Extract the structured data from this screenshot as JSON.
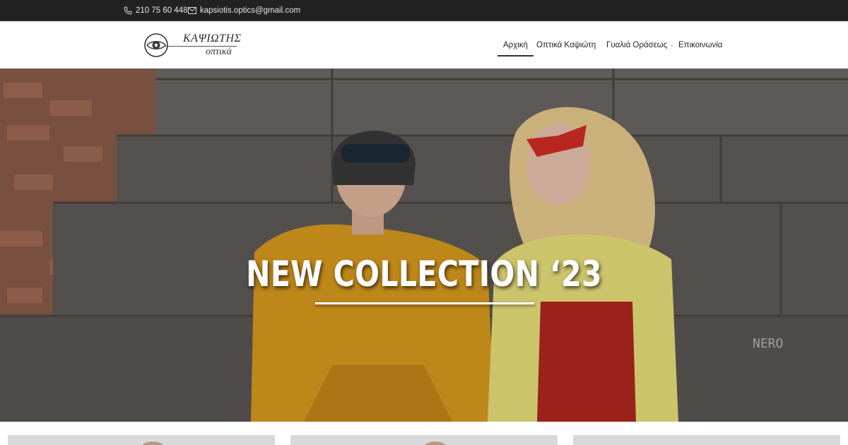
{
  "topbar": {
    "phone": "210 75 60 448",
    "email": "kapsiotis.optics@gmail.com",
    "phone_icon": "phone-icon",
    "email_icon": "envelope-icon"
  },
  "header": {
    "logo": {
      "brand": "ΚΑΨΙΩΤΗΣ",
      "subtitle": "οπτικά"
    },
    "nav": [
      {
        "label": "Αρχική",
        "active": true
      },
      {
        "label": "Οπτικά Καψιώτη",
        "active": false
      },
      {
        "label": "Γυαλιά Οράσεως",
        "active": false,
        "has_dropdown": true
      },
      {
        "label": "Επικοινωνία",
        "active": false
      }
    ]
  },
  "hero": {
    "title": "NEW COLLECTION ‘23",
    "graffiti": "NERO"
  },
  "colors": {
    "topbar_bg": "#222222",
    "header_bg": "#ffffff",
    "hero_text": "#ffffff",
    "card_bg": "#d9d9d9"
  }
}
